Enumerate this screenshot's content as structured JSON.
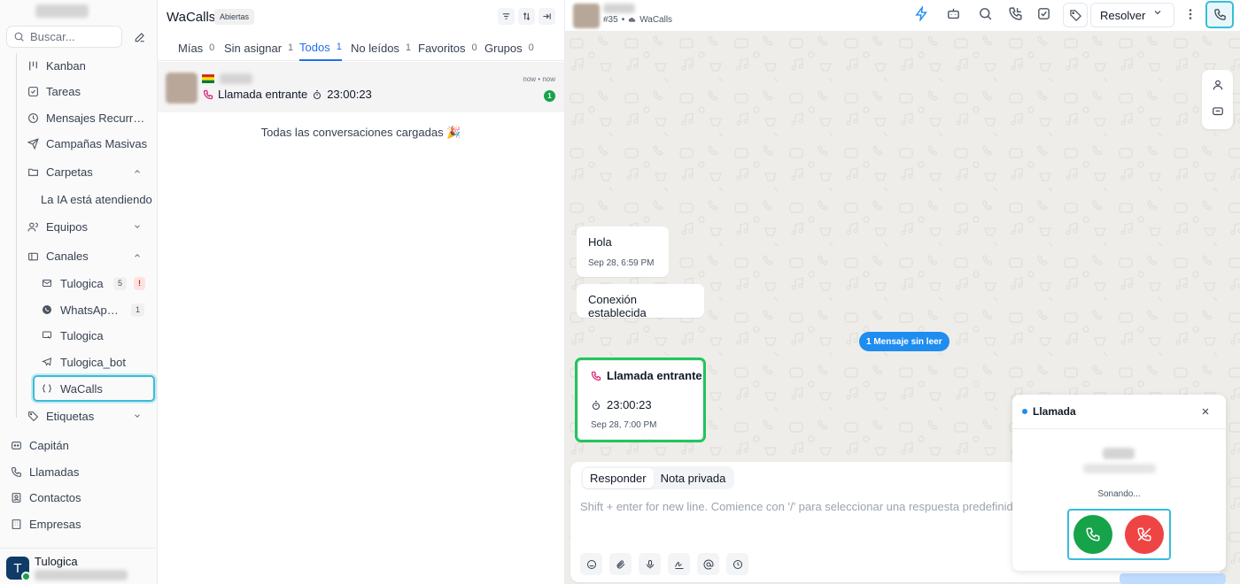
{
  "sidebar": {
    "search_placeholder": "Buscar...",
    "nav": [
      {
        "label": "Kanban",
        "icon": "kanban-icon"
      },
      {
        "label": "Tareas",
        "icon": "tasks-checkbox-icon"
      },
      {
        "label": "Mensajes Recurrentes",
        "icon": "clock-icon"
      },
      {
        "label": "Campañas Masivas",
        "icon": "send-icon"
      },
      {
        "label": "Carpetas",
        "icon": "folder-icon"
      },
      {
        "label": "La IA está atendiendo",
        "icon": ""
      },
      {
        "label": "Equipos",
        "icon": "users-icon"
      },
      {
        "label": "Canales",
        "icon": "channels-icon"
      }
    ],
    "channels": [
      {
        "label": "Tulogica",
        "icon": "mail-icon",
        "count": "5",
        "alert": "!"
      },
      {
        "label": "WhatsApp Cloud",
        "icon": "whatsapp-icon",
        "count": "1"
      },
      {
        "label": "Tulogica",
        "icon": "web-widget-icon"
      },
      {
        "label": "Tulogica_bot",
        "icon": "telegram-icon"
      },
      {
        "label": "WaCalls",
        "icon": "api-braces-icon"
      }
    ],
    "labels_section": "Etiquetas",
    "bottom_nav": [
      {
        "label": "Capitán",
        "icon": "captain-icon"
      },
      {
        "label": "Llamadas",
        "icon": "phone-icon"
      },
      {
        "label": "Contactos",
        "icon": "contacts-icon"
      },
      {
        "label": "Empresas",
        "icon": "building-icon"
      }
    ],
    "user": {
      "initial": "T",
      "name": "Tulogica"
    }
  },
  "conversation_list": {
    "title": "WaCalls",
    "status_badge": "Abiertas",
    "tabs": [
      {
        "label": "Mías",
        "count": "0"
      },
      {
        "label": "Sin asignar",
        "count": "1"
      },
      {
        "label": "Todos",
        "count": "1",
        "active": true
      },
      {
        "label": "No leídos",
        "count": "1"
      },
      {
        "label": "Favoritos",
        "count": "0"
      },
      {
        "label": "Grupos",
        "count": "0"
      }
    ],
    "card": {
      "preview": "Llamada entrante",
      "duration": "23:00:23",
      "time": "now • now",
      "unread": "1"
    },
    "end_message": "Todas las conversaciones cargadas 🎉"
  },
  "chat": {
    "ticket": "#35",
    "inbox": "WaCalls",
    "resolve_label": "Resolver",
    "messages": [
      {
        "text": "Hola",
        "time": "Sep 28, 6:59 PM"
      },
      {
        "text": "Conexión establecida"
      }
    ],
    "unread_divider": "1 Mensaje sin leer",
    "call_message": {
      "title": "Llamada entrante",
      "duration": "23:00:23",
      "time": "Sep 28, 7:00 PM"
    },
    "composer": {
      "tab_reply": "Responder",
      "tab_note": "Nota privada",
      "placeholder": "Shift + enter for new line. Comience con '/' para seleccionar una respuesta predefinida."
    }
  },
  "call_popup": {
    "title": "Llamada",
    "status": "Sonando...",
    "accept_icon": "phone-icon",
    "reject_icon": "phone-off-icon"
  },
  "colors": {
    "accent_blue": "#1f8cf0",
    "highlight_cyan": "#38bdd8",
    "accept_green": "#16a34a",
    "reject_red": "#ef4444",
    "call_bubble_outline": "#22c55e"
  }
}
